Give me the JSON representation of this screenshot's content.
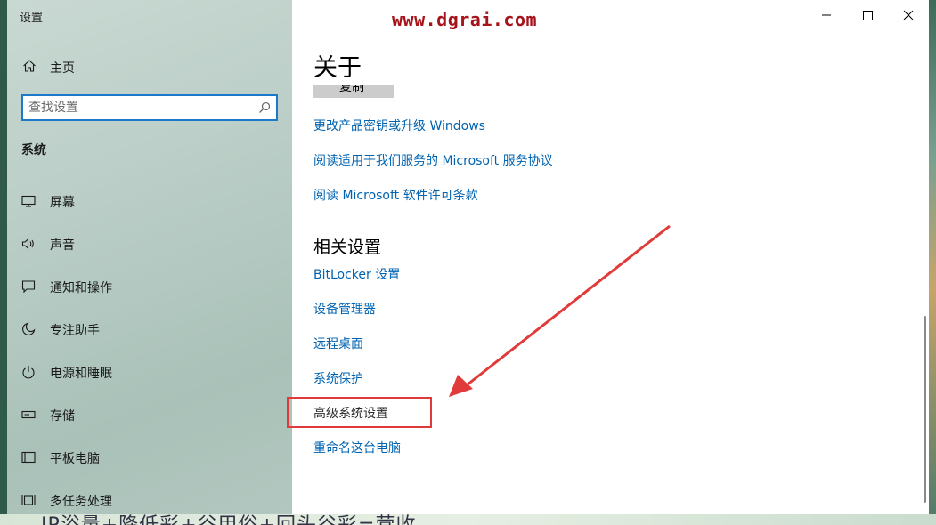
{
  "window": {
    "app_title": "设置",
    "controls": [
      "minimize",
      "maximize",
      "close"
    ]
  },
  "sidebar": {
    "home_label": "主页",
    "search_placeholder": "查找设置",
    "section_label": "系统",
    "items": [
      {
        "label": "屏幕",
        "icon": "monitor-icon"
      },
      {
        "label": "声音",
        "icon": "speaker-icon"
      },
      {
        "label": "通知和操作",
        "icon": "notification-icon"
      },
      {
        "label": "专注助手",
        "icon": "moon-icon"
      },
      {
        "label": "电源和睡眠",
        "icon": "power-icon"
      },
      {
        "label": "存储",
        "icon": "storage-icon"
      },
      {
        "label": "平板电脑",
        "icon": "tablet-icon"
      },
      {
        "label": "多任务处理",
        "icon": "multitask-icon"
      }
    ]
  },
  "content": {
    "watermark": "www.dgrai.com",
    "page_title": "关于",
    "copy_button": "复制",
    "links": [
      "更改产品密钥或升级 Windows",
      "阅读适用于我们服务的 Microsoft 服务协议",
      "阅读 Microsoft 软件许可条款"
    ],
    "related_heading": "相关设置",
    "related_links": [
      "BitLocker 设置",
      "设备管理器",
      "远程桌面",
      "系统保护",
      "高级系统设置",
      "重命名这台电脑"
    ],
    "highlight_color": "#e13a3a",
    "link_color": "#0063b1"
  },
  "background": {
    "bottom_text": "IP浴量+降低彩+谷甲俗+回头谷彩=营收"
  }
}
